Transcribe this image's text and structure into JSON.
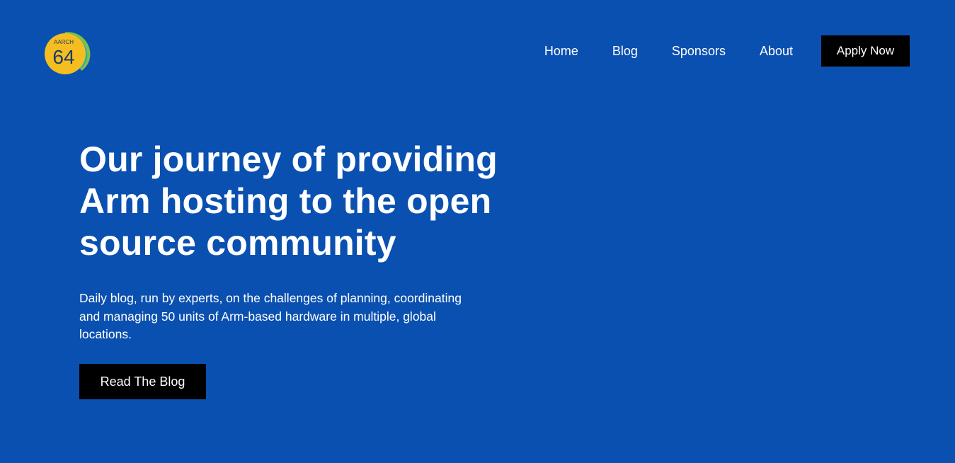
{
  "brand": {
    "logo_top_text": "AARCH",
    "logo_number": "64",
    "colors": {
      "circle": "#f5bd1f",
      "arc_green": "#7cc142",
      "arc_teal": "#1fb0c8",
      "text": "#1a3b6e"
    }
  },
  "nav": {
    "items": [
      {
        "label": "Home"
      },
      {
        "label": "Blog"
      },
      {
        "label": "Sponsors"
      },
      {
        "label": "About"
      }
    ],
    "cta_label": "Apply Now"
  },
  "hero": {
    "title": "Our journey of providing Arm hosting to the open source community",
    "description": "Daily blog, run by experts, on the challenges of planning, coordinating and managing 50 units of Arm-based hardware in multiple, global locations.",
    "button_label": "Read The Blog"
  },
  "colors": {
    "background": "#0a50b0",
    "button": "#000000",
    "text": "#ffffff"
  }
}
